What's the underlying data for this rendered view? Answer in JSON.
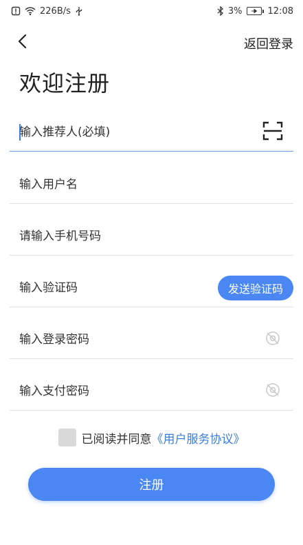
{
  "status_bar": {
    "net_speed": "226B/s",
    "battery_pct": "3%",
    "time": "12:08"
  },
  "header": {
    "back_icon": "chevron-left-icon",
    "login_link": "返回登录"
  },
  "title": "欢迎注册",
  "fields": {
    "referrer": {
      "placeholder": "输入推荐人(必填)",
      "icon": "scan-icon"
    },
    "username": {
      "placeholder": "输入用户名"
    },
    "phone": {
      "placeholder": "请输入手机号码"
    },
    "code": {
      "placeholder": "输入验证码",
      "button": "发送验证码"
    },
    "login_password": {
      "placeholder": "输入登录密码",
      "icon": "eye-off-icon"
    },
    "pay_password": {
      "placeholder": "输入支付密码",
      "icon": "eye-off-icon"
    }
  },
  "agreement": {
    "text": "已阅读并同意",
    "link": "《用户服务协议》",
    "checked": false
  },
  "register_button": "注册",
  "colors": {
    "accent": "#4a87f2",
    "link": "#3a7de0",
    "divider": "#e0e0e0"
  }
}
